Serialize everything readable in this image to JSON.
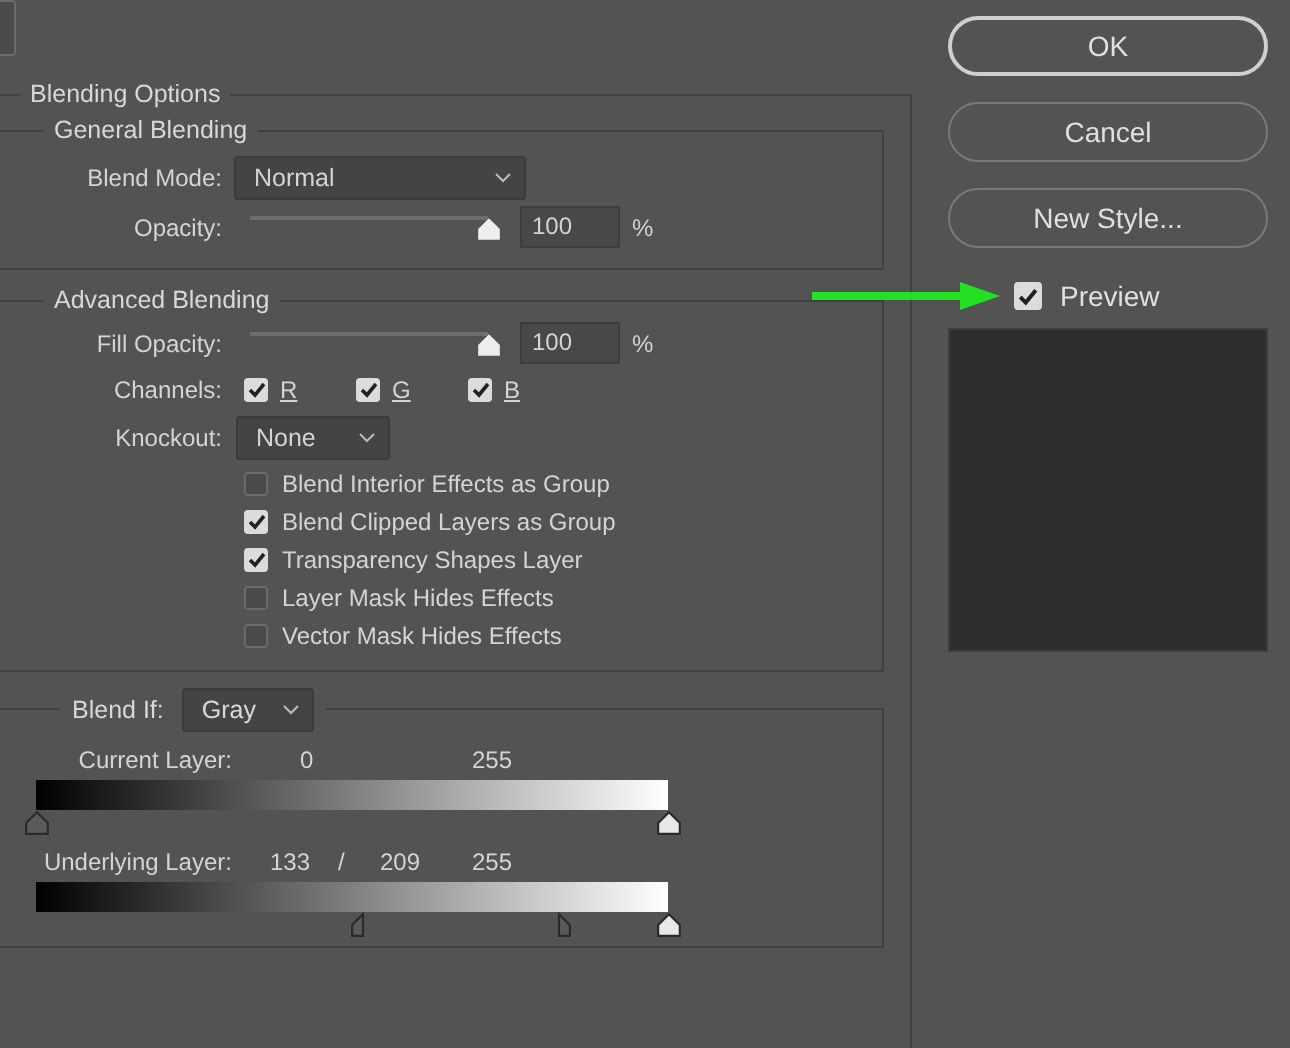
{
  "blending_options": {
    "legend": "Blending Options"
  },
  "general_blending": {
    "legend": "General Blending",
    "blend_mode": {
      "label": "Blend Mode:",
      "value": "Normal"
    },
    "opacity": {
      "label": "Opacity:",
      "level": 1,
      "value": "100",
      "unit": "%"
    }
  },
  "advanced_blending": {
    "legend": "Advanced Blending",
    "fill_opacity": {
      "label": "Fill Opacity:",
      "level": 1,
      "value": "100",
      "unit": "%"
    },
    "channels": {
      "label": "Channels:",
      "items": [
        {
          "label": "R",
          "checked": true
        },
        {
          "label": "G",
          "checked": true
        },
        {
          "label": "B",
          "checked": true
        }
      ]
    },
    "knockout": {
      "label": "Knockout:",
      "value": "None"
    },
    "options": [
      {
        "label": "Blend Interior Effects as Group",
        "checked": false
      },
      {
        "label": "Blend Clipped Layers as Group",
        "checked": true
      },
      {
        "label": "Transparency Shapes Layer",
        "checked": true
      },
      {
        "label": "Layer Mask Hides Effects",
        "checked": false
      },
      {
        "label": "Vector Mask Hides Effects",
        "checked": false
      }
    ]
  },
  "blend_if": {
    "label": "Blend If:",
    "value": "Gray",
    "layers": [
      {
        "label": "Current Layer:",
        "readings": [
          "0",
          "255"
        ],
        "thumbs": [
          {
            "kind": "black",
            "level": 0
          },
          {
            "kind": "white",
            "level": 1
          }
        ]
      },
      {
        "label": "Underlying Layer:",
        "readings": [
          "133",
          "/",
          "209",
          "255"
        ],
        "thumbs": [
          {
            "kind": "black-left-half",
            "level": 0.516
          },
          {
            "kind": "black-right-half",
            "level": 0.826
          },
          {
            "kind": "white",
            "level": 1
          }
        ]
      }
    ]
  },
  "buttons": [
    {
      "label": "OK",
      "default": true
    },
    {
      "label": "Cancel",
      "default": false
    },
    {
      "label": "New Style...",
      "default": false
    }
  ],
  "preview": {
    "label": "Preview",
    "checked": true
  }
}
